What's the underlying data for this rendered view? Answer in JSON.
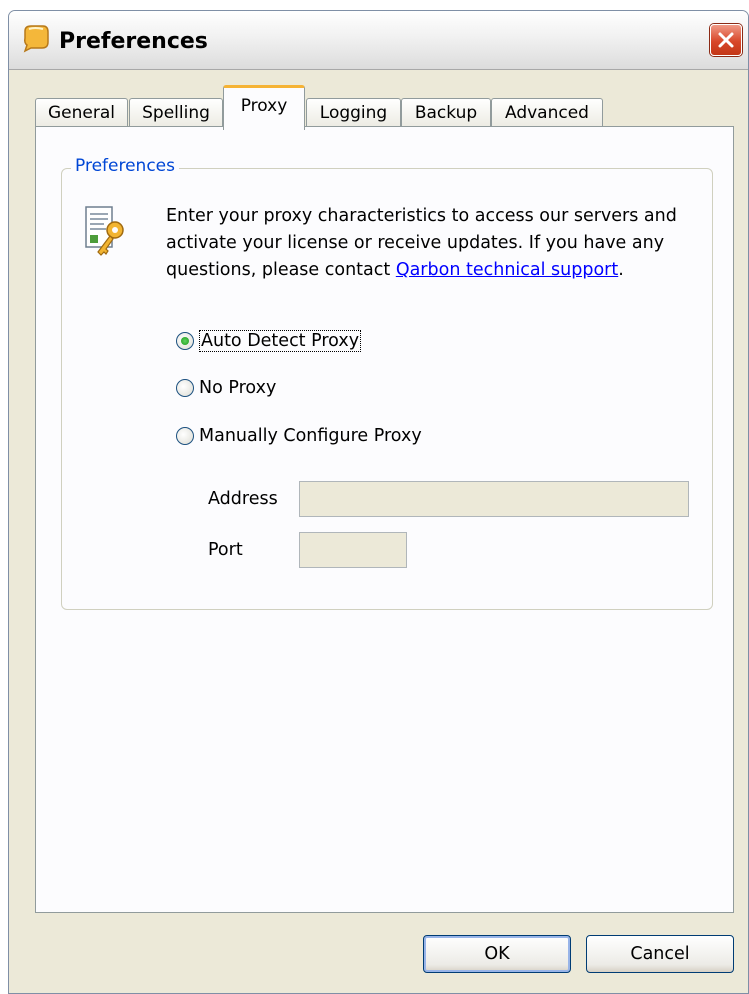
{
  "window": {
    "title": "Preferences"
  },
  "tabs": [
    {
      "label": "General"
    },
    {
      "label": "Spelling"
    },
    {
      "label": "Proxy"
    },
    {
      "label": "Logging"
    },
    {
      "label": "Backup"
    },
    {
      "label": "Advanced"
    }
  ],
  "active_tab": "Proxy",
  "group": {
    "legend": "Preferences",
    "description": "Enter your proxy characteristics to access our servers and activate your license or receive updates. If you have any questions, please contact ",
    "link_text": "Qarbon technical support",
    "description_end": "."
  },
  "proxy_options": [
    {
      "label": "Auto Detect Proxy",
      "checked": true
    },
    {
      "label": "No Proxy",
      "checked": false
    },
    {
      "label": "Manually Configure Proxy",
      "checked": false
    }
  ],
  "fields": {
    "address_label": "Address",
    "address_value": "",
    "port_label": "Port",
    "port_value": ""
  },
  "buttons": {
    "ok": "OK",
    "cancel": "Cancel"
  },
  "icons": {
    "app": "notes-app-icon",
    "close": "close-icon",
    "group": "document-key-icon"
  },
  "colors": {
    "window_bg": "#ece9d8",
    "close_red": "#d8472a",
    "legend_blue": "#0046d5",
    "active_tab_accent": "#f5b335"
  }
}
